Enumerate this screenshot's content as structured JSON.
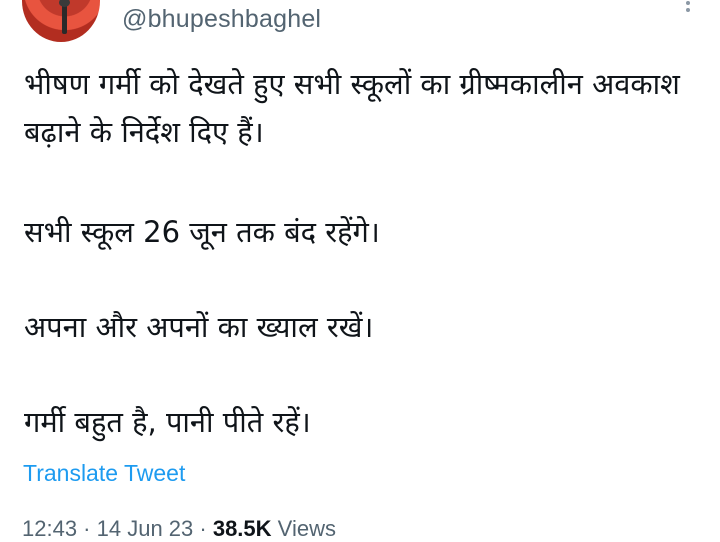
{
  "header": {
    "handle": "@bhupeshbaghel"
  },
  "tweet": {
    "paragraphs": [
      "भीषण गर्मी को देखते हुए सभी स्कूलों का ग्रीष्मकालीन अवकाश बढ़ाने के निर्देश दिए हैं।",
      "सभी स्कूल 26 जून तक बंद रहेंगे।",
      "अपना और अपनों का ख्याल रखें।",
      "गर्मी बहुत है, पानी पीते रहें।"
    ],
    "translate_label": "Translate Tweet"
  },
  "meta": {
    "time": "12:43",
    "separator": " · ",
    "date": "14 Jun 23",
    "views_count": "38.5K",
    "views_label": "Views"
  },
  "colors": {
    "link": "#1d9bf0",
    "secondary_text": "#536471",
    "primary_text": "#0f1419"
  },
  "icons": {
    "more": "more-vertical-icon"
  }
}
